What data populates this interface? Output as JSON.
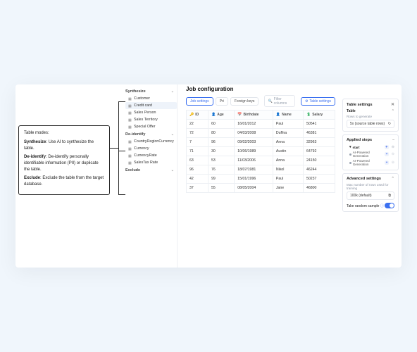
{
  "callout": {
    "heading": "Table modes:",
    "items": [
      {
        "term": "Synthesize",
        "desc": "Use AI to synthesize the table."
      },
      {
        "term": "De-identify",
        "desc": "De-identify personally identifiable information (PII) or duplicate the table."
      },
      {
        "term": "Exclude",
        "desc": "Exclude the table from the target database."
      }
    ]
  },
  "sidebar": {
    "groups": [
      {
        "label": "Synthesize",
        "items": [
          {
            "label": "Customer",
            "icon": "table"
          },
          {
            "label": "Credit card",
            "icon": "table",
            "selected": true
          },
          {
            "label": "Sales Person",
            "icon": "table"
          },
          {
            "label": "Sales Territory",
            "icon": "table"
          },
          {
            "label": "Special Offer",
            "icon": "table"
          }
        ]
      },
      {
        "label": "De-identify",
        "items": [
          {
            "label": "CountryRegionCurrency",
            "icon": "table"
          },
          {
            "label": "Currency",
            "icon": "table"
          },
          {
            "label": "CurrencyRate",
            "icon": "table"
          },
          {
            "label": "SalesTax Rate",
            "icon": "table"
          }
        ]
      },
      {
        "label": "Exclude",
        "items": []
      }
    ]
  },
  "main": {
    "title": "Job configuration",
    "tabs": [
      {
        "label": "Job settings",
        "active": true
      },
      {
        "label": "Pri"
      },
      {
        "label": "Foreign keys"
      }
    ],
    "search_placeholder": "Filter columns",
    "table_settings_btn": "Table settings",
    "columns": [
      {
        "icon": "key",
        "label": "ID"
      },
      {
        "icon": "person",
        "label": "Age"
      },
      {
        "icon": "calendar",
        "label": "Birthdate"
      },
      {
        "icon": "person",
        "label": "Name"
      },
      {
        "icon": "money",
        "label": "Salary"
      }
    ],
    "rows": [
      {
        "id": "22",
        "age": "60",
        "birthdate": "16/01/2012",
        "name": "Paul",
        "salary": "50541"
      },
      {
        "id": "72",
        "age": "80",
        "birthdate": "04/03/2008",
        "name": "Duffna",
        "salary": "46381"
      },
      {
        "id": "7",
        "age": "96",
        "birthdate": "09/02/2003",
        "name": "Anna",
        "salary": "32963"
      },
      {
        "id": "71",
        "age": "30",
        "birthdate": "10/06/1989",
        "name": "Austin",
        "salary": "64792"
      },
      {
        "id": "63",
        "age": "53",
        "birthdate": "11/03/2006",
        "name": "Anna",
        "salary": "24150"
      },
      {
        "id": "96",
        "age": "76",
        "birthdate": "18/07/1981",
        "name": "Nikol",
        "salary": "46244"
      },
      {
        "id": "42",
        "age": "99",
        "birthdate": "15/01/1996",
        "name": "Paul",
        "salary": "50237"
      },
      {
        "id": "37",
        "age": "55",
        "birthdate": "08/05/2004",
        "name": "Jane",
        "salary": "46800"
      }
    ]
  },
  "right": {
    "settings_title": "Table settings",
    "table_section": "Table",
    "rows_label": "Rows to generate",
    "rows_value": "5x (source table rows)",
    "applied_title": "Applied steps",
    "steps": [
      {
        "label": "start",
        "kind": "start"
      },
      {
        "label": "AI-Powered Generation"
      },
      {
        "label": "AI-Powered Generation"
      }
    ],
    "adv_title": "Advanced settings",
    "adv_label": "Max number of rows used for training",
    "adv_value": "100k (default)",
    "toggle_label": "Take random sample",
    "info_icon": "ⓘ"
  }
}
